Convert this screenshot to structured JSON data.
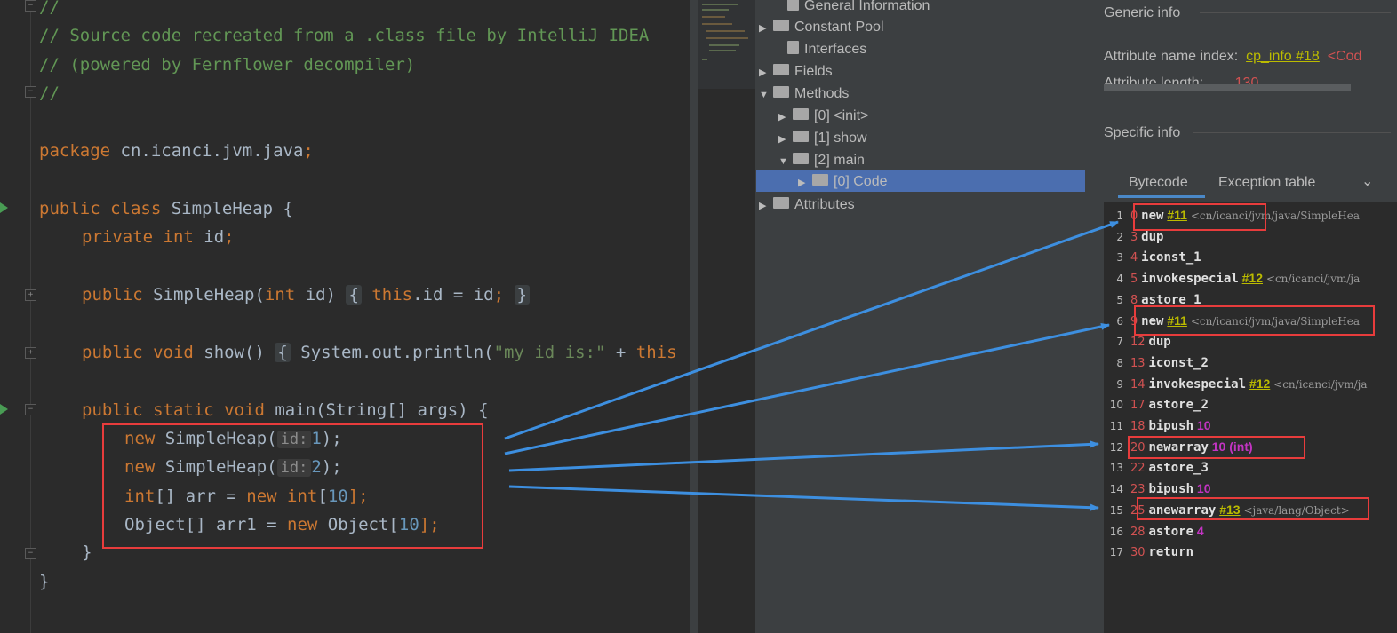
{
  "editor": {
    "lines": [
      {
        "text": "//"
      },
      {
        "text": "// Source code recreated from a .class file by IntelliJ IDEA"
      },
      {
        "text": "// (powered by Fernflower decompiler)"
      },
      {
        "text": "//"
      }
    ],
    "package_kw": "package",
    "package_name": " cn.icanci.jvm.java",
    "semicolon": ";",
    "class_mods": "public class",
    "class_name": " SimpleHeap {",
    "field_mods": "private int",
    "field_name": " id",
    "ctor_mod": "public",
    "ctor_sig": " SimpleHeap(",
    "ctor_int": "int",
    "ctor_param": " id) ",
    "ctor_fold_open": "{",
    "ctor_this": " this",
    "ctor_body": ".id = id",
    "ctor_fold_close": "}",
    "show_mods": "public void",
    "show_sig": " show() ",
    "show_fold_open": "{",
    "show_body": " System.out.println(",
    "show_str": "\"my id is:\"",
    "show_plus": " + ",
    "show_this": "this",
    "main_mods": "public static void",
    "main_sig": " main(String[] args) {",
    "new1_kw": "new",
    "new1_cls": " SimpleHeap(",
    "hint_label": "id:",
    "new1_arg": "1",
    "new1_end": ");",
    "new2_kw": "new",
    "new2_cls": " SimpleHeap(",
    "new2_arg": "2",
    "new2_end": ");",
    "arr_int": "int",
    "arr_mid": "[] arr = ",
    "arr_new": "new",
    "arr_int2": " int",
    "arr_br": "[",
    "arr_size": "10",
    "arr_end": "];",
    "obj_start": "Object[] arr1 = ",
    "obj_new": "new",
    "obj_mid": " Object[",
    "obj_size": "10",
    "obj_end": "];",
    "close_method": "}",
    "close_class": "}"
  },
  "tree": {
    "items": [
      {
        "label": "General Information",
        "arrow": ""
      },
      {
        "label": "Constant Pool",
        "arrow": "▶"
      },
      {
        "label": "Interfaces",
        "arrow": ""
      },
      {
        "label": "Fields",
        "arrow": "▶"
      },
      {
        "label": "Methods",
        "arrow": "▼"
      },
      {
        "label": "[0] <init>",
        "arrow": "▶"
      },
      {
        "label": "[1] show",
        "arrow": "▶"
      },
      {
        "label": "[2] main",
        "arrow": "▼"
      },
      {
        "label": "[0] Code",
        "arrow": "▶"
      },
      {
        "label": "Attributes",
        "arrow": "▶"
      }
    ]
  },
  "generic_info": {
    "title": "Generic info",
    "attr_name_label": "Attribute name index:",
    "attr_name_link": "cp_info #18",
    "attr_name_value": "<Cod",
    "attr_len_label": "Attribute length:",
    "attr_len_value": "130"
  },
  "specific_info": {
    "title": "Specific info",
    "tabs": [
      "Bytecode",
      "Exception table"
    ]
  },
  "bytecode": [
    {
      "ln": "1",
      "off": "0",
      "op": "new",
      "ref": "#11",
      "extra": "",
      "cls": "<cn/icanci/jvm/java/SimpleHea"
    },
    {
      "ln": "2",
      "off": "3",
      "op": "dup",
      "ref": "",
      "extra": "",
      "cls": ""
    },
    {
      "ln": "3",
      "off": "4",
      "op": "iconst_1",
      "ref": "",
      "extra": "",
      "cls": ""
    },
    {
      "ln": "4",
      "off": "5",
      "op": "invokespecial",
      "ref": "#12",
      "extra": "",
      "cls": "<cn/icanci/jvm/ja"
    },
    {
      "ln": "5",
      "off": "8",
      "op": "astore_1",
      "ref": "",
      "extra": "",
      "cls": ""
    },
    {
      "ln": "6",
      "off": "9",
      "op": "new",
      "ref": "#11",
      "extra": "",
      "cls": "<cn/icanci/jvm/java/SimpleHea"
    },
    {
      "ln": "7",
      "off": "12",
      "op": "dup",
      "ref": "",
      "extra": "",
      "cls": ""
    },
    {
      "ln": "8",
      "off": "13",
      "op": "iconst_2",
      "ref": "",
      "extra": "",
      "cls": ""
    },
    {
      "ln": "9",
      "off": "14",
      "op": "invokespecial",
      "ref": "#12",
      "extra": "",
      "cls": "<cn/icanci/jvm/ja"
    },
    {
      "ln": "10",
      "off": "17",
      "op": "astore_2",
      "ref": "",
      "extra": "",
      "cls": ""
    },
    {
      "ln": "11",
      "off": "18",
      "op": "bipush",
      "ref": "",
      "extra": "10",
      "cls": ""
    },
    {
      "ln": "12",
      "off": "20",
      "op": "newarray",
      "ref": "",
      "extra": "10 (int)",
      "cls": ""
    },
    {
      "ln": "13",
      "off": "22",
      "op": "astore_3",
      "ref": "",
      "extra": "",
      "cls": ""
    },
    {
      "ln": "14",
      "off": "23",
      "op": "bipush",
      "ref": "",
      "extra": "10",
      "cls": ""
    },
    {
      "ln": "15",
      "off": "25",
      "op": "anewarray",
      "ref": "#13",
      "extra": "",
      "cls": "<java/lang/Object>"
    },
    {
      "ln": "16",
      "off": "28",
      "op": "astore",
      "ref": "",
      "extra": "4",
      "cls": ""
    },
    {
      "ln": "17",
      "off": "30",
      "op": "return",
      "ref": "",
      "extra": "",
      "cls": ""
    }
  ],
  "colors": {
    "annotation_red": "#e83c3c",
    "arrow_blue": "#3d8fe0",
    "selection_blue": "#4b6eaf"
  }
}
